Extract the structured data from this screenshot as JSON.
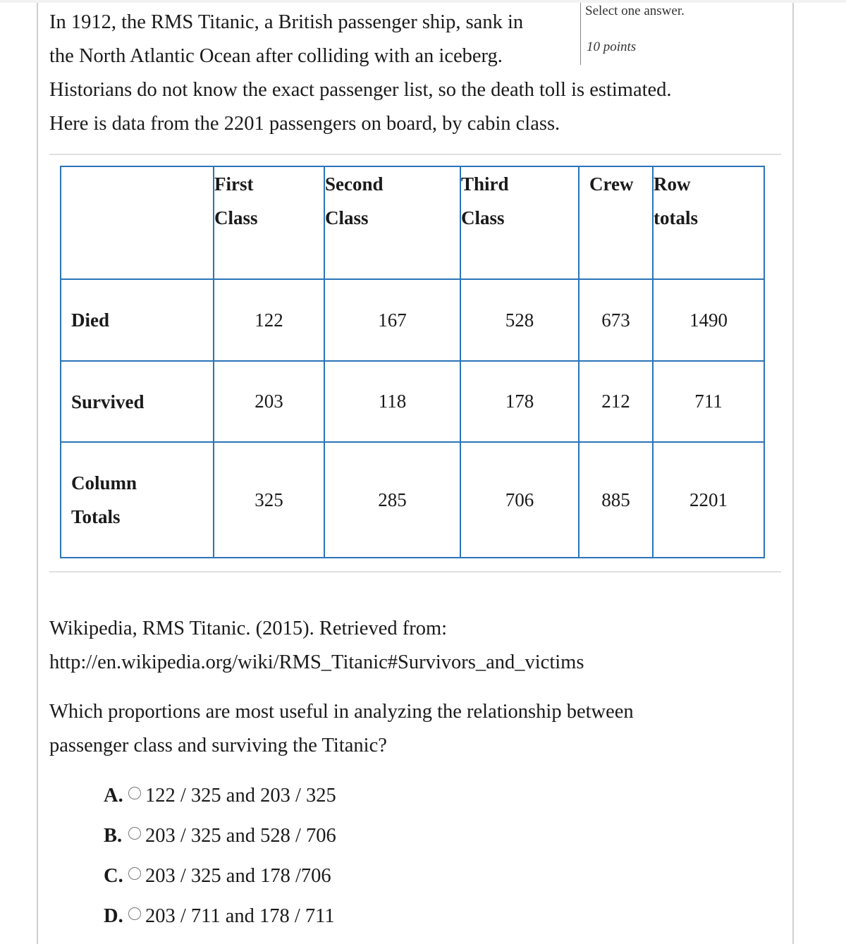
{
  "intro": {
    "line1": "In 1912, the RMS Titanic, a British passenger ship, sank in",
    "line2": "the North Atlantic Ocean after colliding with an iceberg.",
    "line3": "Historians do not know the exact passenger list, so the death toll is estimated.",
    "line4": "Here is data from the 2201 passengers on board, by cabin class."
  },
  "aside": {
    "instruction": "Select one answer.",
    "points": "10 points"
  },
  "table": {
    "headers": [
      {
        "line1": "",
        "line2": ""
      },
      {
        "line1": "First",
        "line2": "Class"
      },
      {
        "line1": "Second",
        "line2": "Class"
      },
      {
        "line1": "Third",
        "line2": "Class"
      },
      {
        "line1": "Crew",
        "line2": ""
      },
      {
        "line1": "Row",
        "line2": "totals"
      }
    ],
    "rows": [
      {
        "label1": "Died",
        "label2": "",
        "values": [
          "122",
          "167",
          "528",
          "673",
          "1490"
        ]
      },
      {
        "label1": "Survived",
        "label2": "",
        "values": [
          "203",
          "118",
          "178",
          "212",
          "711"
        ]
      },
      {
        "label1": "Column",
        "label2": "Totals",
        "values": [
          "325",
          "285",
          "706",
          "885",
          "2201"
        ]
      }
    ]
  },
  "citation": {
    "line1": "Wikipedia, RMS Titanic. (2015). Retrieved from:",
    "line2": "http://en.wikipedia.org/wiki/RMS_Titanic#Survivors_and_victims"
  },
  "question": {
    "line1": "Which proportions are most useful in analyzing the relationship between",
    "line2": "passenger class and surviving the Titanic?"
  },
  "choices": [
    {
      "letter": "A.",
      "text": "122 / 325 and 203 / 325",
      "selected": false
    },
    {
      "letter": "B.",
      "text": "203 / 325 and 528 / 706",
      "selected": false
    },
    {
      "letter": "C.",
      "text": "203 / 325 and 178 /706",
      "selected": false
    },
    {
      "letter": "D.",
      "text": "203 / 711 and 178 / 711",
      "selected": false
    }
  ],
  "colors": {
    "table_border": "#2b74b8",
    "divider": "#e0e0e0"
  }
}
